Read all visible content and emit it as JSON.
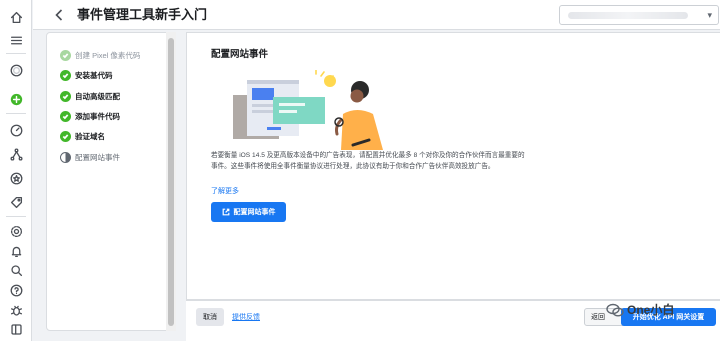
{
  "header": {
    "title": "事件管理工具新手入门"
  },
  "rail": {
    "icons": [
      "home-icon",
      "menu-icon",
      "avatar",
      "create-plus-icon",
      "dashboard-icon",
      "network-icon",
      "star-icon",
      "tag-icon",
      "settings-icon",
      "bell-icon",
      "search-icon",
      "help-icon",
      "bug-icon",
      "panel-icon"
    ]
  },
  "steps": [
    {
      "label": "创建 Pixel 像素代码",
      "state": "faded"
    },
    {
      "label": "安装基代码",
      "state": "done"
    },
    {
      "label": "自动高级匹配",
      "state": "done"
    },
    {
      "label": "添加事件代码",
      "state": "done"
    },
    {
      "label": "验证域名",
      "state": "done"
    },
    {
      "label": "配置网站事件",
      "state": "current"
    }
  ],
  "main": {
    "title": "配置网站事件",
    "description": "若要衡量 iOS 14.5 及更高版本设备中的广告表现，请配置并优化最多 8 个对你及你的合作伙伴而言最重要的事件。这些事件将使用全事件衡量协议进行处理，此协议有助于你和合作广告伙伴高效投放广告。",
    "learn_more": "了解更多",
    "cta_label": "配置网站事件"
  },
  "footer": {
    "cancel_label": "取消",
    "feedback_label": "提供反馈",
    "back_label": "返回",
    "next_label": "开始优化 API 网关设置"
  },
  "watermark": {
    "text": "One小白"
  },
  "colors": {
    "primary": "#1877f2",
    "success": "#42b72a",
    "illus_teal": "#7fd8c4",
    "illus_yellow": "#ffd84f"
  }
}
